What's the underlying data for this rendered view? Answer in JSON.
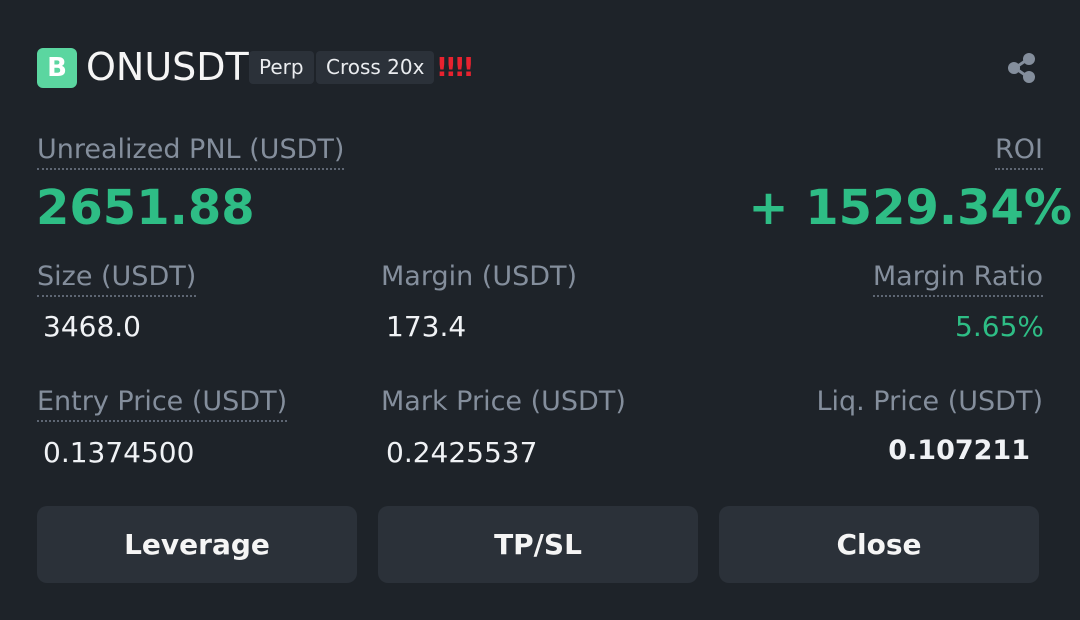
{
  "header": {
    "logo_letter": "B",
    "symbol": "ONUSDT",
    "tag_type": "Perp",
    "tag_margin": "Cross 20x",
    "warning": "!!!!",
    "share_icon": "share-icon"
  },
  "pnl": {
    "label": "Unrealized PNL (USDT)",
    "value": "2651.88"
  },
  "roi": {
    "label": "ROI",
    "value": "+ 1529.34%"
  },
  "size": {
    "label": "Size (USDT)",
    "value": "3468.0"
  },
  "margin": {
    "label": "Margin (USDT)",
    "value": "173.4"
  },
  "margin_ratio": {
    "label": "Margin Ratio",
    "value": "5.65%"
  },
  "entry_price": {
    "label": "Entry Price (USDT)",
    "value": "0.1374500"
  },
  "mark_price": {
    "label": "Mark Price (USDT)",
    "value": "0.2425537"
  },
  "liq_price": {
    "label": "Liq. Price (USDT)",
    "value": "0.107211"
  },
  "buttons": {
    "leverage": "Leverage",
    "tpsl": "TP/SL",
    "close": "Close"
  },
  "colors": {
    "background": "#1e2329",
    "positive": "#2ebd85",
    "warning": "#e8222f",
    "logo": "#5bd6a0"
  }
}
